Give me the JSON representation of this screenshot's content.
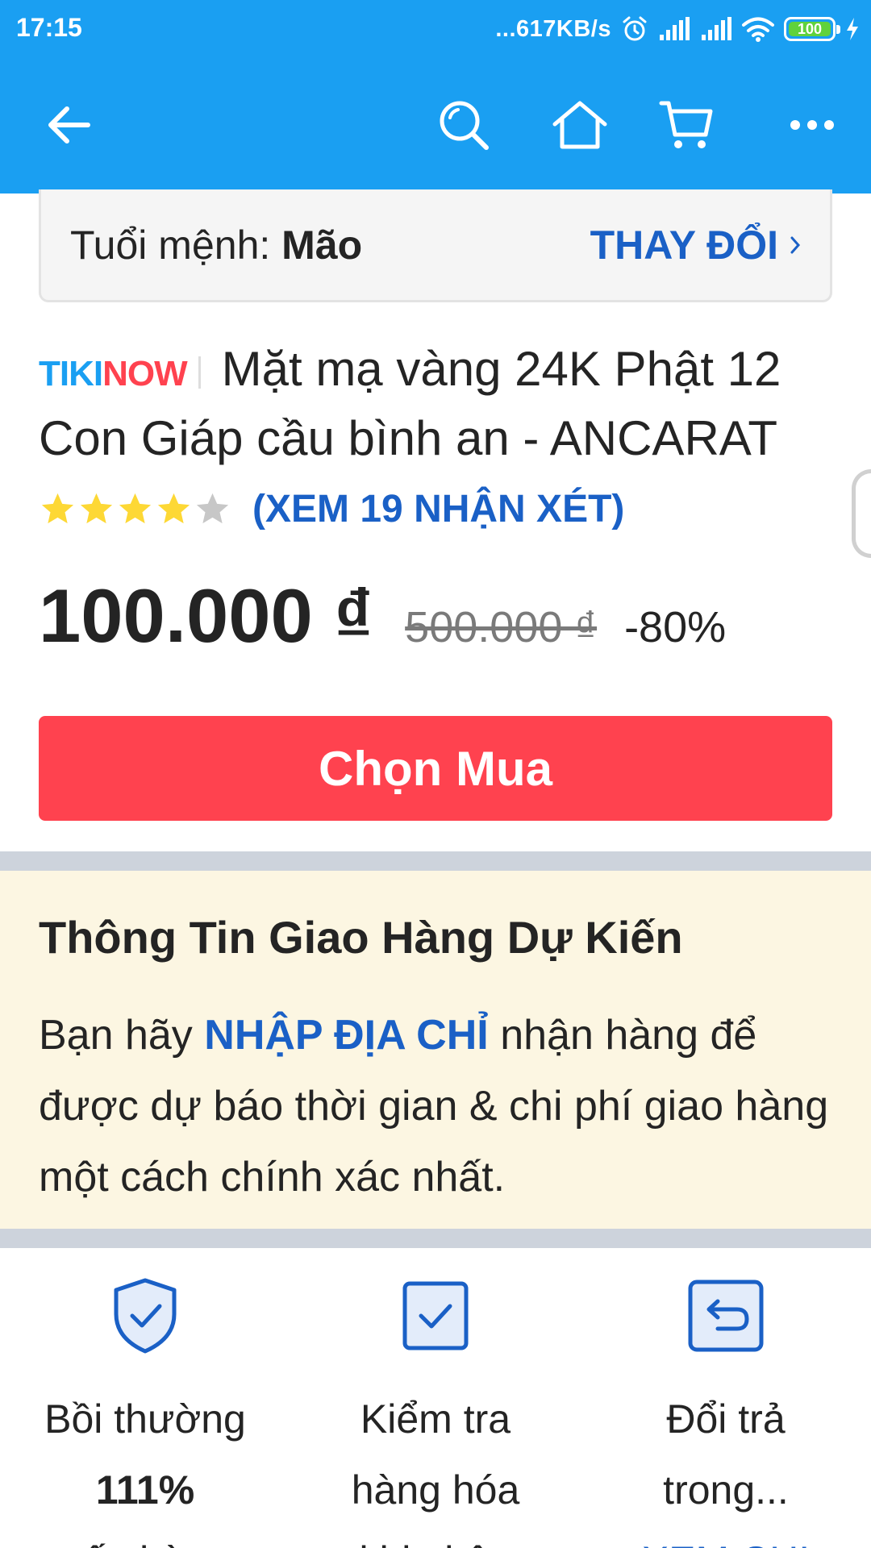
{
  "status_bar": {
    "time": "17:15",
    "net_speed": "...617KB/s",
    "battery": "100"
  },
  "toolbar": {
    "icons": [
      "back-arrow-icon",
      "search-icon",
      "home-icon",
      "cart-icon",
      "more-icon"
    ]
  },
  "zodiac": {
    "label": "Tuổi mệnh: ",
    "value": "Mão",
    "change_label": "THAY ĐỔI"
  },
  "product": {
    "badge_tiki": "TIKI",
    "badge_now": "NOW",
    "title": "Mặt mạ vàng 24K Phật 12 Con Giáp cầu bình an - ANCARAT",
    "rating": 4,
    "rating_max": 5,
    "reviews_label": "(XEM 19 NHẬN XÉT)",
    "price": "100.000 ₫",
    "original_price": "500.000 ₫",
    "discount": "-80%",
    "buy_label": "Chọn Mua"
  },
  "delivery": {
    "title": "Thông Tin Giao Hàng Dự Kiến",
    "text_before": "Bạn hãy ",
    "link": "NHẬP ĐỊA CHỈ",
    "text_after": " nhận hàng để được dự báo thời gian & chi phí giao hàng một cách chính xác nhất."
  },
  "benefits": [
    {
      "line1": "Bồi thường",
      "line2": "111%",
      "line3": "nếu hàng"
    },
    {
      "line1": "Kiểm tra",
      "line2": "hàng hóa",
      "line3": "khi nhận"
    },
    {
      "line1": "Đổi trả",
      "line2": "trong...",
      "line3": "XEM CHI"
    }
  ],
  "colors": {
    "header_blue": "#1a9ff2",
    "link_blue": "#1a60c6",
    "buy_red": "#ff424f",
    "delivery_bg": "#fcf6e2",
    "star_yellow": "#fdd835",
    "star_grey": "#c7c7c7"
  }
}
